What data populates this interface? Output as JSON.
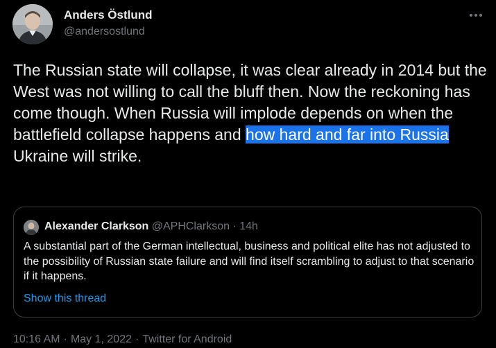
{
  "tweet": {
    "author_name": "Anders Östlund",
    "author_handle": "@andersostlund",
    "text_before": "The Russian state will collapse, it was clear already in 2014 but the West was not willing to call the bluff then. Now the reckoning has come though. When Russia will implode depends on when the battlefield collapse happens and ",
    "text_highlight": "how hard and far into Russia",
    "text_after": " Ukraine will strike.",
    "time": "10:16 AM",
    "separator": "·",
    "date": "May 1, 2022",
    "source": "Twitter for Android",
    "more_icon": "more-horizontal-icon"
  },
  "quote": {
    "author_name": "Alexander Clarkson",
    "author_handle": "@APHClarkson",
    "separator": "·",
    "time": "14h",
    "text": "A substantial part of the German intellectual, business and political elite has not adjusted to the possibility of Russian state failure and will find itself scrambling to adjust to that scenario if it happens.",
    "show_thread": "Show this thread"
  },
  "colors": {
    "background": "#000000",
    "text": "#e7e9ea",
    "secondary": "#71767b",
    "link": "#1d9bf0",
    "highlight": "#1a73e8",
    "border": "#3a3f44"
  }
}
